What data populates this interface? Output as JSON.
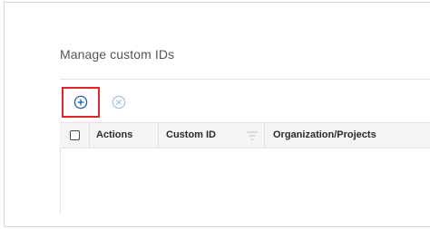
{
  "panel": {
    "title": "Manage custom IDs"
  },
  "toolbar": {
    "add_icon": "plus-circle-icon",
    "clear_icon": "x-circle-icon",
    "highlight_color": "#d9272e",
    "add_color": "#1e5fa8",
    "clear_color": "#a9c4e2"
  },
  "table": {
    "columns": [
      {
        "label": "Actions"
      },
      {
        "label": "Custom ID"
      },
      {
        "label": "Organization/Projects"
      }
    ],
    "rows": []
  }
}
